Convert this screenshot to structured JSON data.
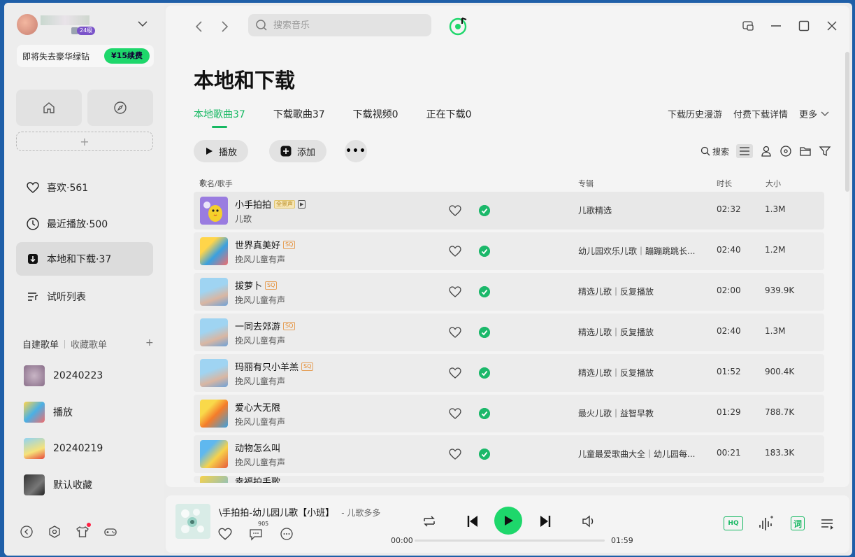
{
  "sidebar": {
    "vip_badge": "24级",
    "renew_text": "即将失去豪华绿钻",
    "renew_button": "¥15续费",
    "nav": [
      {
        "label": "喜欢·561",
        "icon": "heart-icon"
      },
      {
        "label": "最近播放·500",
        "icon": "clock-icon"
      },
      {
        "label": "本地和下载·37",
        "icon": "download-icon"
      },
      {
        "label": "试听列表",
        "icon": "playlist-icon"
      }
    ],
    "playlist_tabs": [
      "自建歌单",
      "收藏歌单"
    ],
    "playlist_add": "+",
    "playlists": [
      "20240223",
      "播放",
      "20240219",
      "默认收藏"
    ]
  },
  "topbar": {
    "search_placeholder": "搜索音乐"
  },
  "page": {
    "title": "本地和下载",
    "tabs": [
      "本地歌曲37",
      "下载歌曲37",
      "下载视频0",
      "正在下载0"
    ],
    "right_links": [
      "下载历史漫游",
      "付费下载详情",
      "更多"
    ],
    "play_label": "播放",
    "add_label": "添加",
    "search_label": "搜索"
  },
  "table": {
    "headers": {
      "title": "歌名/歌手",
      "album": "专辑",
      "duration": "时长",
      "size": "大小"
    },
    "rows": [
      {
        "title": "小手拍拍",
        "artist": "儿歌",
        "album": "儿歌精选",
        "duration": "02:32",
        "size": "1.3M",
        "tags": [
          "全景声",
          "mv"
        ]
      },
      {
        "title": "世界真美好",
        "artist": "挽风儿童有声",
        "album": "幼儿园欢乐儿歌｜蹦蹦跳跳长...",
        "duration": "02:40",
        "size": "1.2M",
        "tags": [
          "SQ"
        ]
      },
      {
        "title": "拔萝卜",
        "artist": "挽风儿童有声",
        "album": "精选儿歌｜反复播放",
        "duration": "02:00",
        "size": "939.9K",
        "tags": [
          "SQ"
        ]
      },
      {
        "title": "一同去郊游",
        "artist": "挽风儿童有声",
        "album": "精选儿歌｜反复播放",
        "duration": "02:40",
        "size": "1.3M",
        "tags": [
          "SQ"
        ]
      },
      {
        "title": "玛丽有只小羊羔",
        "artist": "挽风儿童有声",
        "album": "精选儿歌｜反复播放",
        "duration": "01:52",
        "size": "900.4K",
        "tags": [
          "SQ"
        ]
      },
      {
        "title": "爱心大无限",
        "artist": "挽风儿童有声",
        "album": "最火儿歌｜益智早教",
        "duration": "01:29",
        "size": "788.7K",
        "tags": []
      },
      {
        "title": "动物怎么叫",
        "artist": "挽风儿童有声",
        "album": "儿童最爱歌曲大全｜幼儿园每...",
        "duration": "00:21",
        "size": "183.3K",
        "tags": []
      },
      {
        "title": "幸福拍手歌",
        "artist": "",
        "album": "",
        "duration": "",
        "size": "",
        "tags": []
      }
    ]
  },
  "player": {
    "title": "\\手拍拍-幼儿园儿歌【小班】",
    "artist": "- 儿歌多多",
    "comment_count": "905",
    "time_current": "00:00",
    "time_total": "01:59",
    "progress": 0,
    "hq_label": "HQ",
    "lyrics_label": "词"
  },
  "colors": {
    "accent": "#1ed76b",
    "accent_text": "#16b862"
  }
}
